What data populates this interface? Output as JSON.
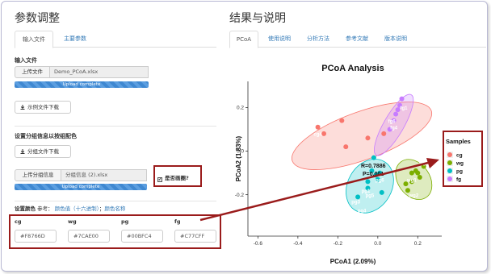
{
  "left": {
    "title": "参数调整",
    "tabs": [
      {
        "label": "输入文件"
      },
      {
        "label": "主要参数"
      }
    ],
    "input_file": {
      "label": "输入文件",
      "upload_button": "上传文件",
      "file_name": "Demo_PCoA.xlsx",
      "progress_text": "Upload complete",
      "progress": 1.0,
      "example_button": "示例文件下载"
    },
    "group": {
      "label": "设置分组信息以按组配色",
      "download_button": "分组文件下载",
      "upload_button": "上传分组信息",
      "file_name": "分组信息 (2).xlsx",
      "progress_text": "Upload complete",
      "progress": 1.0,
      "checkbox_label": "是否画圈?",
      "checkbox_checked": true,
      "checkbox_mark": "✔"
    },
    "colors": {
      "label": "设置颜色",
      "ref_prefix": "参考：",
      "link_hex": "颜色值（十六进制）",
      "separator": "；",
      "link_names": "颜色名称",
      "fields": [
        {
          "name": "cg",
          "value": "#F8766D"
        },
        {
          "name": "wg",
          "value": "#7CAE00"
        },
        {
          "name": "pg",
          "value": "#00BFC4"
        },
        {
          "name": "fg",
          "value": "#C77CFF"
        }
      ]
    }
  },
  "right": {
    "title": "结果与说明",
    "tabs": [
      {
        "label": "PCoA"
      },
      {
        "label": "使用说明"
      },
      {
        "label": "分析方法"
      },
      {
        "label": "参考文献"
      },
      {
        "label": "版本说明"
      }
    ]
  },
  "chart_data": {
    "type": "scatter",
    "title": "PCoA Analysis",
    "xlabel": "PCoA1 (2.09%)",
    "ylabel": "PCoA2 (1.83%)",
    "xlim": [
      -0.65,
      0.32
    ],
    "ylim": [
      -0.39,
      0.32
    ],
    "xticks": [
      "-0.6",
      "-0.4",
      "-0.2",
      "0.0",
      "0.2"
    ],
    "xtick_values": [
      -0.6,
      -0.4,
      -0.2,
      0.0,
      0.2
    ],
    "yticks": [
      "0.2",
      "0.0",
      "-0.2"
    ],
    "ytick_values": [
      0.2,
      0.0,
      -0.2
    ],
    "annotation_r": "R=0.7886",
    "annotation_p": "P=0.001",
    "legend": {
      "title": "Samples",
      "position": "right"
    },
    "series": [
      {
        "name": "cg",
        "color": "#F8766D",
        "points": [
          [
            -0.3,
            0.11
          ],
          [
            -0.27,
            0.08
          ],
          [
            -0.18,
            0.14
          ],
          [
            -0.16,
            0.02
          ],
          [
            -0.05,
            0.06
          ],
          [
            0.03,
            0.08
          ]
        ],
        "labels": [
          {
            "text": "cg4",
            "x": -0.3,
            "y": 0.07
          }
        ],
        "ellipse": {
          "cx": -0.08,
          "cy": 0.07,
          "rx": 0.37,
          "ry": 0.11,
          "angle": -20
        }
      },
      {
        "name": "wg",
        "color": "#7CAE00",
        "points": [
          [
            0.17,
            -0.1
          ],
          [
            0.19,
            -0.09
          ],
          [
            0.2,
            -0.1
          ],
          [
            0.21,
            -0.12
          ],
          [
            0.17,
            -0.14
          ],
          [
            0.15,
            -0.18
          ],
          [
            0.14,
            -0.15
          ],
          [
            0.23,
            -0.07
          ]
        ],
        "labels": [
          {
            "text": "wg5",
            "x": 0.23,
            "y": -0.06
          },
          {
            "text": "wg1",
            "x": 0.17,
            "y": -0.14
          },
          {
            "text": "wg2",
            "x": 0.18,
            "y": -0.21
          }
        ],
        "ellipse": {
          "cx": 0.18,
          "cy": -0.13,
          "rx": 0.08,
          "ry": 0.1,
          "angle": -35
        }
      },
      {
        "name": "pg",
        "color": "#00BFC4",
        "points": [
          [
            -0.03,
            -0.09
          ],
          [
            -0.01,
            -0.11
          ],
          [
            0.0,
            -0.13
          ],
          [
            -0.05,
            -0.14
          ],
          [
            -0.1,
            -0.21
          ],
          [
            -0.05,
            -0.17
          ],
          [
            0.02,
            -0.19
          ],
          [
            0.01,
            -0.1
          ],
          [
            -0.02,
            -0.03
          ]
        ],
        "labels": [
          {
            "text": "pg6",
            "x": 0.01,
            "y": -0.14
          },
          {
            "text": "pg1",
            "x": -0.06,
            "y": -0.19
          },
          {
            "text": "pg5",
            "x": -0.04,
            "y": -0.21
          },
          {
            "text": "pg3",
            "x": -0.11,
            "y": -0.24
          },
          {
            "text": "pg4",
            "x": -0.08,
            "y": -0.28
          }
        ],
        "ellipse": {
          "cx": -0.04,
          "cy": -0.16,
          "rx": 0.11,
          "ry": 0.13,
          "angle": 30
        }
      },
      {
        "name": "fg",
        "color": "#C77CFF",
        "points": [
          [
            0.1,
            0.19
          ],
          [
            0.12,
            0.24
          ],
          [
            0.11,
            0.21
          ],
          [
            0.08,
            0.14
          ],
          [
            0.06,
            0.1
          ],
          [
            0.09,
            0.17
          ]
        ],
        "labels": [
          {
            "text": "fg1",
            "x": 0.13,
            "y": 0.19
          },
          {
            "text": "fg6",
            "x": 0.07,
            "y": 0.13
          },
          {
            "text": "fg4",
            "x": 0.08,
            "y": 0.1
          },
          {
            "text": "fg3",
            "x": 0.1,
            "y": 0.26
          }
        ],
        "ellipse": {
          "cx": 0.08,
          "cy": 0.12,
          "rx": 0.05,
          "ry": 0.16,
          "angle": 30
        }
      }
    ]
  }
}
